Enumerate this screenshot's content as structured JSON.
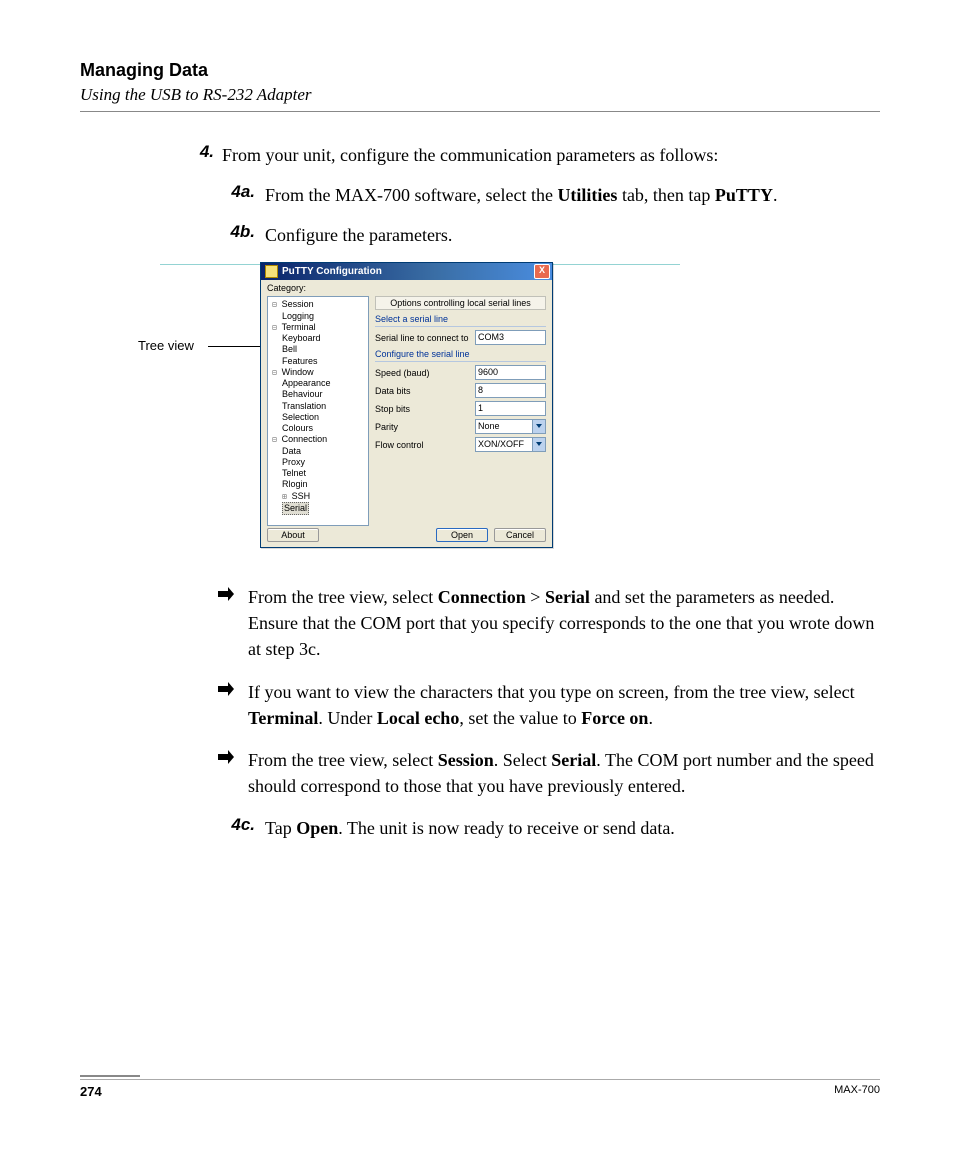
{
  "header": {
    "title": "Managing Data",
    "subtitle": "Using the USB to RS-232 Adapter"
  },
  "step4": {
    "num": "4.",
    "text": "From your unit, configure the communication parameters as follows:"
  },
  "subs": {
    "a": {
      "num": "4a.",
      "pre": "From the MAX-700 software, select the ",
      "b1": "Utilities",
      "mid": " tab, then tap ",
      "b2": "PuTTY",
      "post": "."
    },
    "b": {
      "num": "4b.",
      "text": "Configure the parameters."
    },
    "c": {
      "num": "4c.",
      "pre": "Tap ",
      "b1": "Open",
      "post": ". The unit is now ready to receive or send data."
    }
  },
  "callout": {
    "label": "Tree view"
  },
  "putty": {
    "title": "PuTTY Configuration",
    "close": "X",
    "categoryLabel": "Category:",
    "tree": {
      "session": "Session",
      "logging": "Logging",
      "terminal": "Terminal",
      "keyboard": "Keyboard",
      "bell": "Bell",
      "features": "Features",
      "window": "Window",
      "appearance": "Appearance",
      "behaviour": "Behaviour",
      "translation": "Translation",
      "selection": "Selection",
      "colours": "Colours",
      "connection": "Connection",
      "data": "Data",
      "proxy": "Proxy",
      "telnet": "Telnet",
      "rlogin": "Rlogin",
      "ssh": "SSH",
      "serial": "Serial"
    },
    "panel": {
      "heading": "Options controlling local serial lines",
      "group1": "Select a serial line",
      "serialLineLabel": "Serial line to connect to",
      "serialLineValue": "COM3",
      "group2": "Configure the serial line",
      "speedLabel": "Speed (baud)",
      "speedValue": "9600",
      "dataBitsLabel": "Data bits",
      "dataBitsValue": "8",
      "stopBitsLabel": "Stop bits",
      "stopBitsValue": "1",
      "parityLabel": "Parity",
      "parityValue": "None",
      "flowLabel": "Flow control",
      "flowValue": "XON/XOFF"
    },
    "buttons": {
      "about": "About",
      "open": "Open",
      "cancel": "Cancel"
    }
  },
  "bullets": {
    "b1": {
      "pre": "From the tree view, select ",
      "b1": "Connection",
      "gt": " > ",
      "b2": "Serial",
      "post": " and set the parameters as needed. Ensure that the COM port that you specify corresponds to the one that you wrote down at step 3c."
    },
    "b2": {
      "pre": "If you want to view the characters that you type on screen, from the tree view, select ",
      "b1": "Terminal",
      "mid1": ". Under ",
      "b2": "Local echo",
      "mid2": ", set the value to ",
      "b3": "Force on",
      "post": "."
    },
    "b3": {
      "pre": "From the tree view, select ",
      "b1": "Session",
      "mid1": ". Select ",
      "b2": "Serial",
      "post": ". The COM port number and the speed should correspond to those that you have previously entered."
    }
  },
  "footer": {
    "page": "274",
    "model": "MAX-700"
  }
}
